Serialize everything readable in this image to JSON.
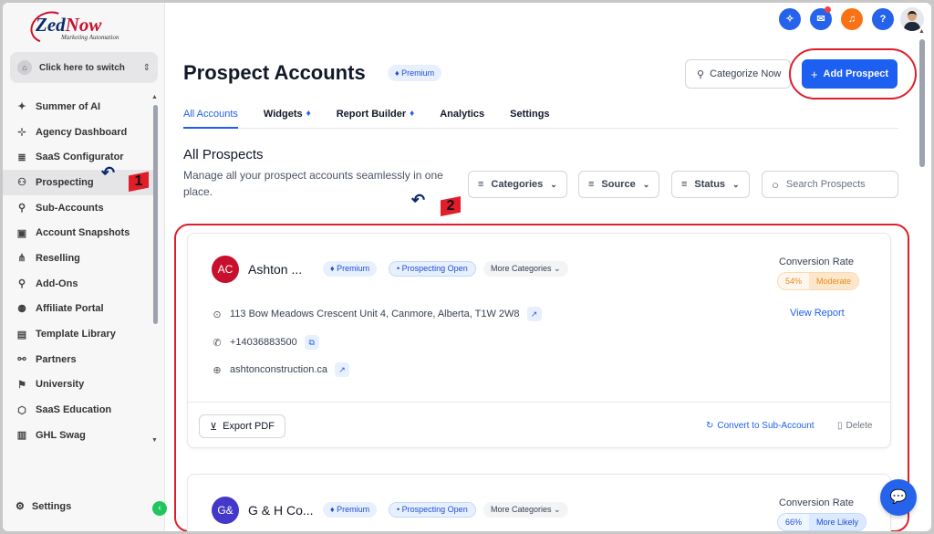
{
  "logo": {
    "brand_a": "Zed",
    "brand_b": "Now",
    "tagline": "Marketing Automation"
  },
  "switcher": {
    "label": "Click here to switch"
  },
  "sidebar": {
    "items": [
      {
        "label": "Summer of AI",
        "icon": "sparkle-icon",
        "glyph": "✦"
      },
      {
        "label": "Agency Dashboard",
        "icon": "dashboard-icon",
        "glyph": "⊹"
      },
      {
        "label": "SaaS Configurator",
        "icon": "chart-icon",
        "glyph": "≣"
      },
      {
        "label": "Prospecting",
        "icon": "people-icon",
        "glyph": "⚇"
      },
      {
        "label": "Sub-Accounts",
        "icon": "user-icon",
        "glyph": "⚲"
      },
      {
        "label": "Account Snapshots",
        "icon": "snapshot-icon",
        "glyph": "▣"
      },
      {
        "label": "Reselling",
        "icon": "network-icon",
        "glyph": "⋔"
      },
      {
        "label": "Add-Ons",
        "icon": "addon-icon",
        "glyph": "⚲"
      },
      {
        "label": "Affiliate Portal",
        "icon": "group-icon",
        "glyph": "⚉"
      },
      {
        "label": "Template Library",
        "icon": "book-icon",
        "glyph": "▤"
      },
      {
        "label": "Partners",
        "icon": "handshake-icon",
        "glyph": "⚯"
      },
      {
        "label": "University",
        "icon": "graduation-icon",
        "glyph": "⚑"
      },
      {
        "label": "SaaS Education",
        "icon": "cube-icon",
        "glyph": "⬡"
      },
      {
        "label": "GHL Swag",
        "icon": "shirt-icon",
        "glyph": "▥"
      }
    ],
    "active_index": 3,
    "settings_label": "Settings"
  },
  "topbar": {
    "icons": [
      "ai-icon",
      "megaphone-icon",
      "bell-icon",
      "help-icon",
      "avatar"
    ],
    "colors": {
      "ai": "#2563eb",
      "megaphone": "#2563eb",
      "bell": "#f97316",
      "help": "#2563eb"
    }
  },
  "header": {
    "title": "Prospect Accounts",
    "badge": "Premium",
    "categorize_label": "Categorize Now",
    "add_label": "Add Prospect"
  },
  "tabs": [
    {
      "label": "All Accounts",
      "diamond": false
    },
    {
      "label": "Widgets",
      "diamond": true
    },
    {
      "label": "Report Builder",
      "diamond": true
    },
    {
      "label": "Analytics",
      "diamond": false
    },
    {
      "label": "Settings",
      "diamond": false
    }
  ],
  "section": {
    "title": "All Prospects",
    "subtitle": "Manage all your prospect accounts seamlessly in one place."
  },
  "filters": {
    "categories": "Categories",
    "source": "Source",
    "status": "Status",
    "search_placeholder": "Search Prospects"
  },
  "prospects": [
    {
      "initials": "AC",
      "avatar_color": "#c8102e",
      "name": "Ashton ...",
      "premium": "Premium",
      "status": "• Prospecting Open",
      "more": "More Categories",
      "conversion_label": "Conversion Rate",
      "conversion_pct": "54%",
      "conversion_text": "Moderate",
      "view_report": "View Report",
      "address": "113 Bow Meadows Crescent Unit 4, Canmore, Alberta, T1W 2W8",
      "phone": "+14036883500",
      "website": "ashtonconstruction.ca",
      "export_label": "Export PDF",
      "convert_label": "Convert to Sub-Account",
      "delete_label": "Delete"
    },
    {
      "initials": "G&",
      "avatar_color": "#4338ca",
      "name": "G & H Co...",
      "premium": "Premium",
      "status": "• Prospecting Open",
      "more": "More Categories",
      "conversion_label": "Conversion Rate",
      "conversion_pct": "66%",
      "conversion_text": "More Likely"
    }
  ],
  "annotations": {
    "one": "1",
    "two": "2"
  }
}
